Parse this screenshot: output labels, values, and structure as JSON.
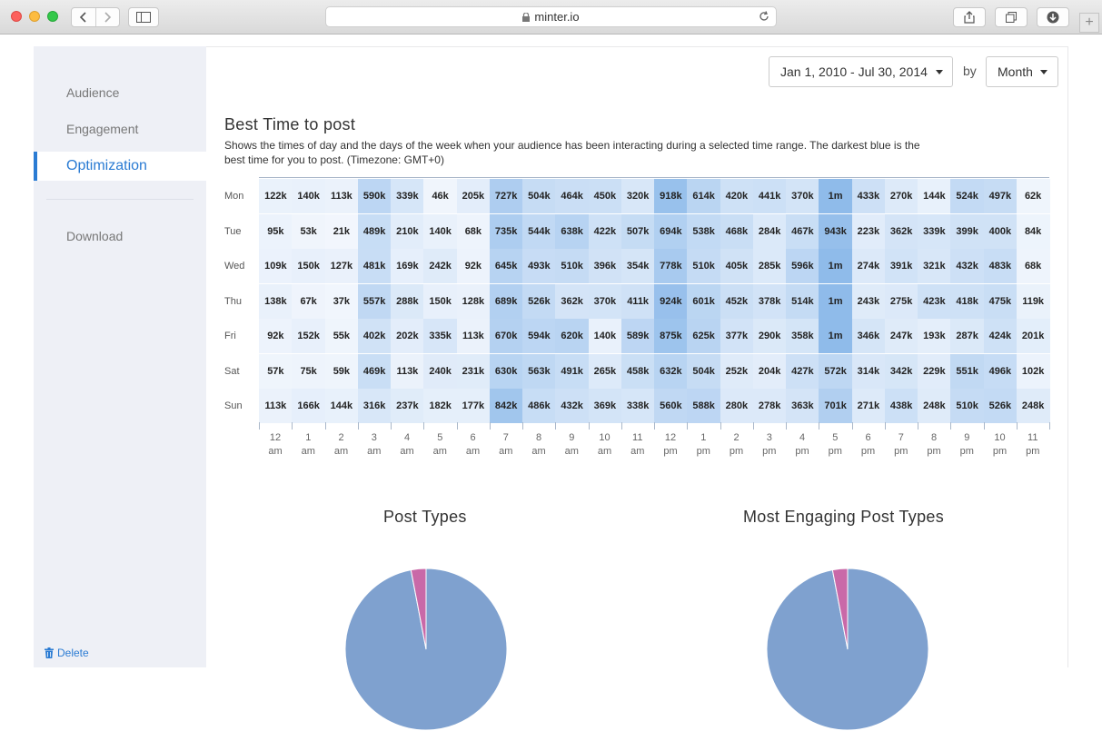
{
  "browser": {
    "url": "minter.io"
  },
  "sidebar": {
    "items": [
      {
        "label": "Audience"
      },
      {
        "label": "Engagement"
      },
      {
        "label": "Optimization"
      },
      {
        "label": "Download"
      }
    ],
    "delete_label": "Delete"
  },
  "controls": {
    "date_range": "Jan 1, 2010 - Jul 30, 2014",
    "by_label": "by",
    "period": "Month"
  },
  "best_time": {
    "title": "Best Time to post",
    "description_line1": "Shows the times of day and the days of the week when your audience has been interacting during a selected time range. The darkest blue is the",
    "description_line2": "best time for you to post. (Timezone: GMT+0)"
  },
  "chart_data": [
    {
      "type": "heatmap",
      "title": "Best Time to post",
      "y": [
        "Mon",
        "Tue",
        "Wed",
        "Thu",
        "Fri",
        "Sat",
        "Sun"
      ],
      "x": [
        {
          "hour": "12",
          "period": "am"
        },
        {
          "hour": "1",
          "period": "am"
        },
        {
          "hour": "2",
          "period": "am"
        },
        {
          "hour": "3",
          "period": "am"
        },
        {
          "hour": "4",
          "period": "am"
        },
        {
          "hour": "5",
          "period": "am"
        },
        {
          "hour": "6",
          "period": "am"
        },
        {
          "hour": "7",
          "period": "am"
        },
        {
          "hour": "8",
          "period": "am"
        },
        {
          "hour": "9",
          "period": "am"
        },
        {
          "hour": "10",
          "period": "am"
        },
        {
          "hour": "11",
          "period": "am"
        },
        {
          "hour": "12",
          "period": "pm"
        },
        {
          "hour": "1",
          "period": "pm"
        },
        {
          "hour": "2",
          "period": "pm"
        },
        {
          "hour": "3",
          "period": "pm"
        },
        {
          "hour": "4",
          "period": "pm"
        },
        {
          "hour": "5",
          "period": "pm"
        },
        {
          "hour": "6",
          "period": "pm"
        },
        {
          "hour": "7",
          "period": "pm"
        },
        {
          "hour": "8",
          "period": "pm"
        },
        {
          "hour": "9",
          "period": "pm"
        },
        {
          "hour": "10",
          "period": "pm"
        },
        {
          "hour": "11",
          "period": "pm"
        }
      ],
      "values": [
        [
          "122k",
          "140k",
          "113k",
          "590k",
          "339k",
          "46k",
          "205k",
          "727k",
          "504k",
          "464k",
          "450k",
          "320k",
          "918k",
          "614k",
          "420k",
          "441k",
          "370k",
          "1m",
          "433k",
          "270k",
          "144k",
          "524k",
          "497k",
          "62k"
        ],
        [
          "95k",
          "53k",
          "21k",
          "489k",
          "210k",
          "140k",
          "68k",
          "735k",
          "544k",
          "638k",
          "422k",
          "507k",
          "694k",
          "538k",
          "468k",
          "284k",
          "467k",
          "943k",
          "223k",
          "362k",
          "339k",
          "399k",
          "400k",
          "84k"
        ],
        [
          "109k",
          "150k",
          "127k",
          "481k",
          "169k",
          "242k",
          "92k",
          "645k",
          "493k",
          "510k",
          "396k",
          "354k",
          "778k",
          "510k",
          "405k",
          "285k",
          "596k",
          "1m",
          "274k",
          "391k",
          "321k",
          "432k",
          "483k",
          "68k"
        ],
        [
          "138k",
          "67k",
          "37k",
          "557k",
          "288k",
          "150k",
          "128k",
          "689k",
          "526k",
          "362k",
          "370k",
          "411k",
          "924k",
          "601k",
          "452k",
          "378k",
          "514k",
          "1m",
          "243k",
          "275k",
          "423k",
          "418k",
          "475k",
          "119k"
        ],
        [
          "92k",
          "152k",
          "55k",
          "402k",
          "202k",
          "335k",
          "113k",
          "670k",
          "594k",
          "620k",
          "140k",
          "589k",
          "875k",
          "625k",
          "377k",
          "290k",
          "358k",
          "1m",
          "346k",
          "247k",
          "193k",
          "287k",
          "424k",
          "201k"
        ],
        [
          "57k",
          "75k",
          "59k",
          "469k",
          "113k",
          "240k",
          "231k",
          "630k",
          "563k",
          "491k",
          "265k",
          "458k",
          "632k",
          "504k",
          "252k",
          "204k",
          "427k",
          "572k",
          "314k",
          "342k",
          "229k",
          "551k",
          "496k",
          "102k"
        ],
        [
          "113k",
          "166k",
          "144k",
          "316k",
          "237k",
          "182k",
          "177k",
          "842k",
          "486k",
          "432k",
          "369k",
          "338k",
          "560k",
          "588k",
          "280k",
          "278k",
          "363k",
          "701k",
          "271k",
          "438k",
          "248k",
          "510k",
          "526k",
          "248k"
        ]
      ],
      "colors": {
        "low": "#f3f7fd",
        "high": "#8fbbea"
      }
    },
    {
      "type": "pie",
      "title": "Post Types",
      "slices": [
        {
          "value": 97,
          "color": "#7fa1cf"
        },
        {
          "value": 3,
          "color": "#c969a8"
        }
      ]
    },
    {
      "type": "pie",
      "title": "Most Engaging Post Types",
      "slices": [
        {
          "value": 97,
          "color": "#7fa1cf"
        },
        {
          "value": 3,
          "color": "#c969a8"
        }
      ]
    }
  ]
}
